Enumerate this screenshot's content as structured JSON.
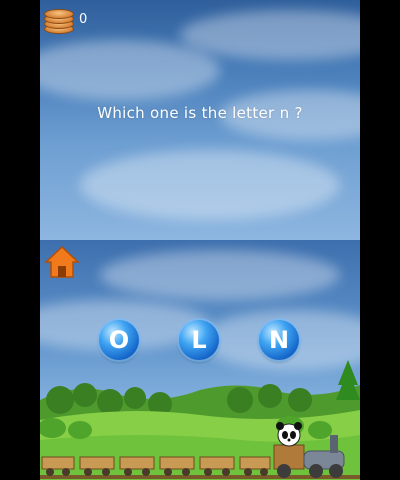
{
  "hud": {
    "coin_icon": "coin-stack-icon",
    "coin_count": "0"
  },
  "question": {
    "prefix": "Which one is the letter",
    "blank": "n",
    "suffix": " ?"
  },
  "home_button": {
    "icon": "home-icon"
  },
  "answers": [
    {
      "letter": "O"
    },
    {
      "letter": "L"
    },
    {
      "letter": "N"
    }
  ],
  "scene": {
    "character": "panda-icon",
    "vehicle": "train-icon"
  },
  "colors": {
    "bubble": "#1f7ee0",
    "sky": "#4a7fbb",
    "grass": "#6fc23b",
    "home": "#f07a1c"
  }
}
